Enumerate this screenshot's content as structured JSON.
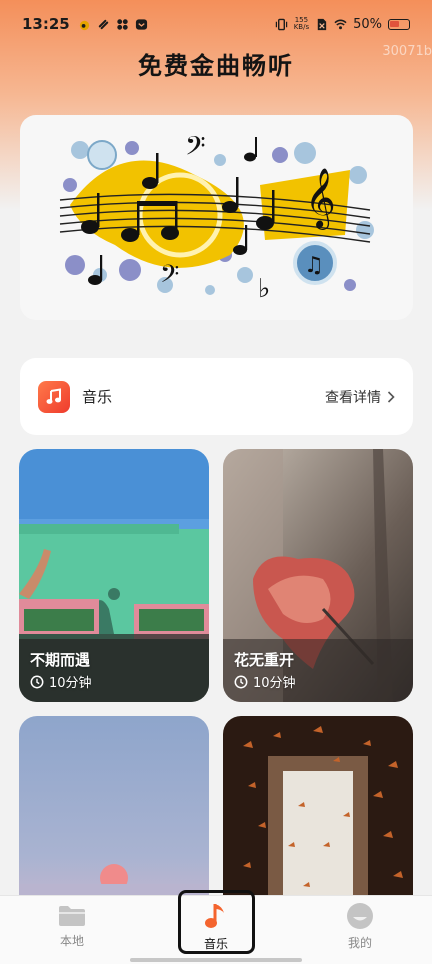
{
  "status_bar": {
    "time": "13:25",
    "net_speed_value": "155",
    "net_speed_unit": "KB/s",
    "battery": "50%"
  },
  "watermark": "30071b",
  "page": {
    "title": "免费金曲畅听"
  },
  "music_card": {
    "label": "音乐",
    "link": "查看详情"
  },
  "tiles": [
    {
      "title": "不期而遇",
      "duration": "10分钟"
    },
    {
      "title": "花无重开",
      "duration": "10分钟"
    },
    {
      "title": "",
      "duration": ""
    },
    {
      "title": "",
      "duration": ""
    }
  ],
  "bottom_nav": {
    "items": [
      {
        "label": "本地",
        "icon": "folder-icon"
      },
      {
        "label": "音乐",
        "icon": "music-note-icon",
        "active": true
      },
      {
        "label": "我的",
        "icon": "profile-icon"
      }
    ]
  },
  "colors": {
    "accent": "#f4642e",
    "header_gradient_top": "#f48f5a"
  }
}
